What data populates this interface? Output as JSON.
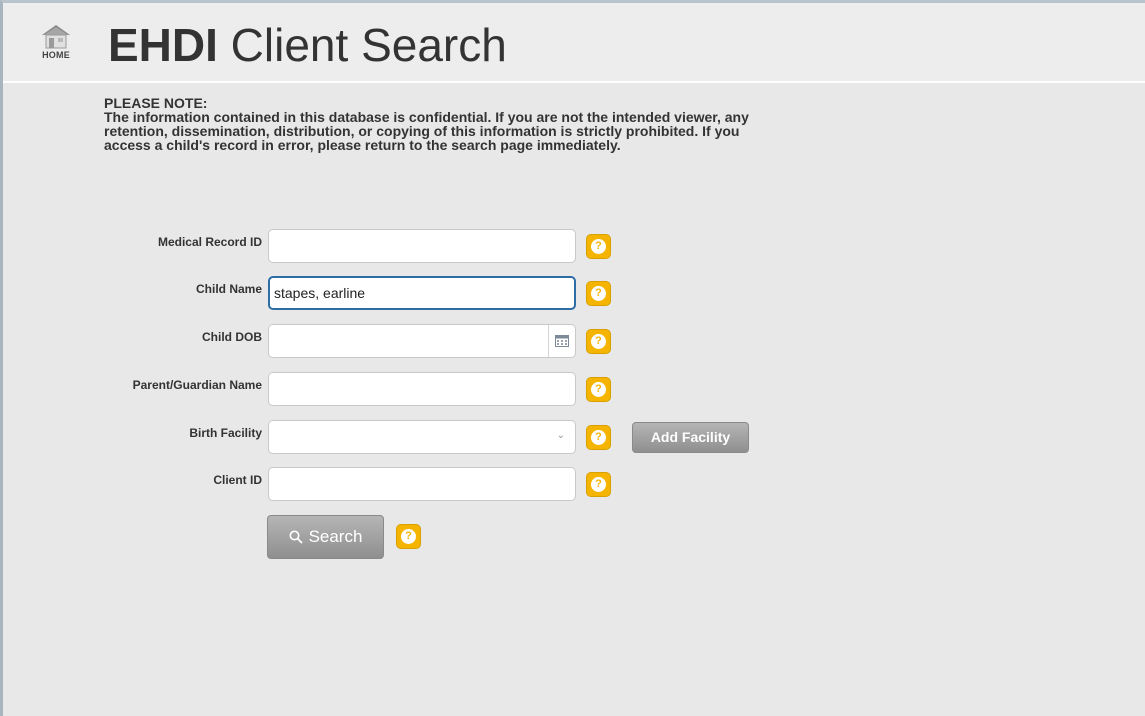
{
  "header": {
    "home_label": "HOME",
    "title_bold": "EHDI",
    "title_rest": " Client Search"
  },
  "note": {
    "heading": "PLEASE NOTE:",
    "body": "The information contained in this database is confidential. If you are not the intended viewer, any retention, dissemination, distribution, or copying of this information is strictly prohibited. If you access a child's record in error, please return to the search page immediately."
  },
  "form": {
    "medical_record_id": {
      "label": "Medical Record ID",
      "value": ""
    },
    "child_name": {
      "label": "Child Name",
      "value": "stapes, earline"
    },
    "child_dob": {
      "label": "Child DOB",
      "value": ""
    },
    "parent_guardian_name": {
      "label": "Parent/Guardian Name",
      "value": ""
    },
    "birth_facility": {
      "label": "Birth Facility",
      "value": ""
    },
    "client_id": {
      "label": "Client ID",
      "value": ""
    },
    "add_facility_label": "Add Facility",
    "search_label": "Search",
    "help_glyph": "?"
  },
  "icons": {
    "home": "home-icon",
    "calendar": "calendar-icon",
    "search": "search-icon",
    "help": "help-icon",
    "chevron": "chevron-down-icon"
  },
  "colors": {
    "help_badge": "#f5b400",
    "focus_border": "#2e6da4",
    "button_gray": "#9e9e9e"
  }
}
